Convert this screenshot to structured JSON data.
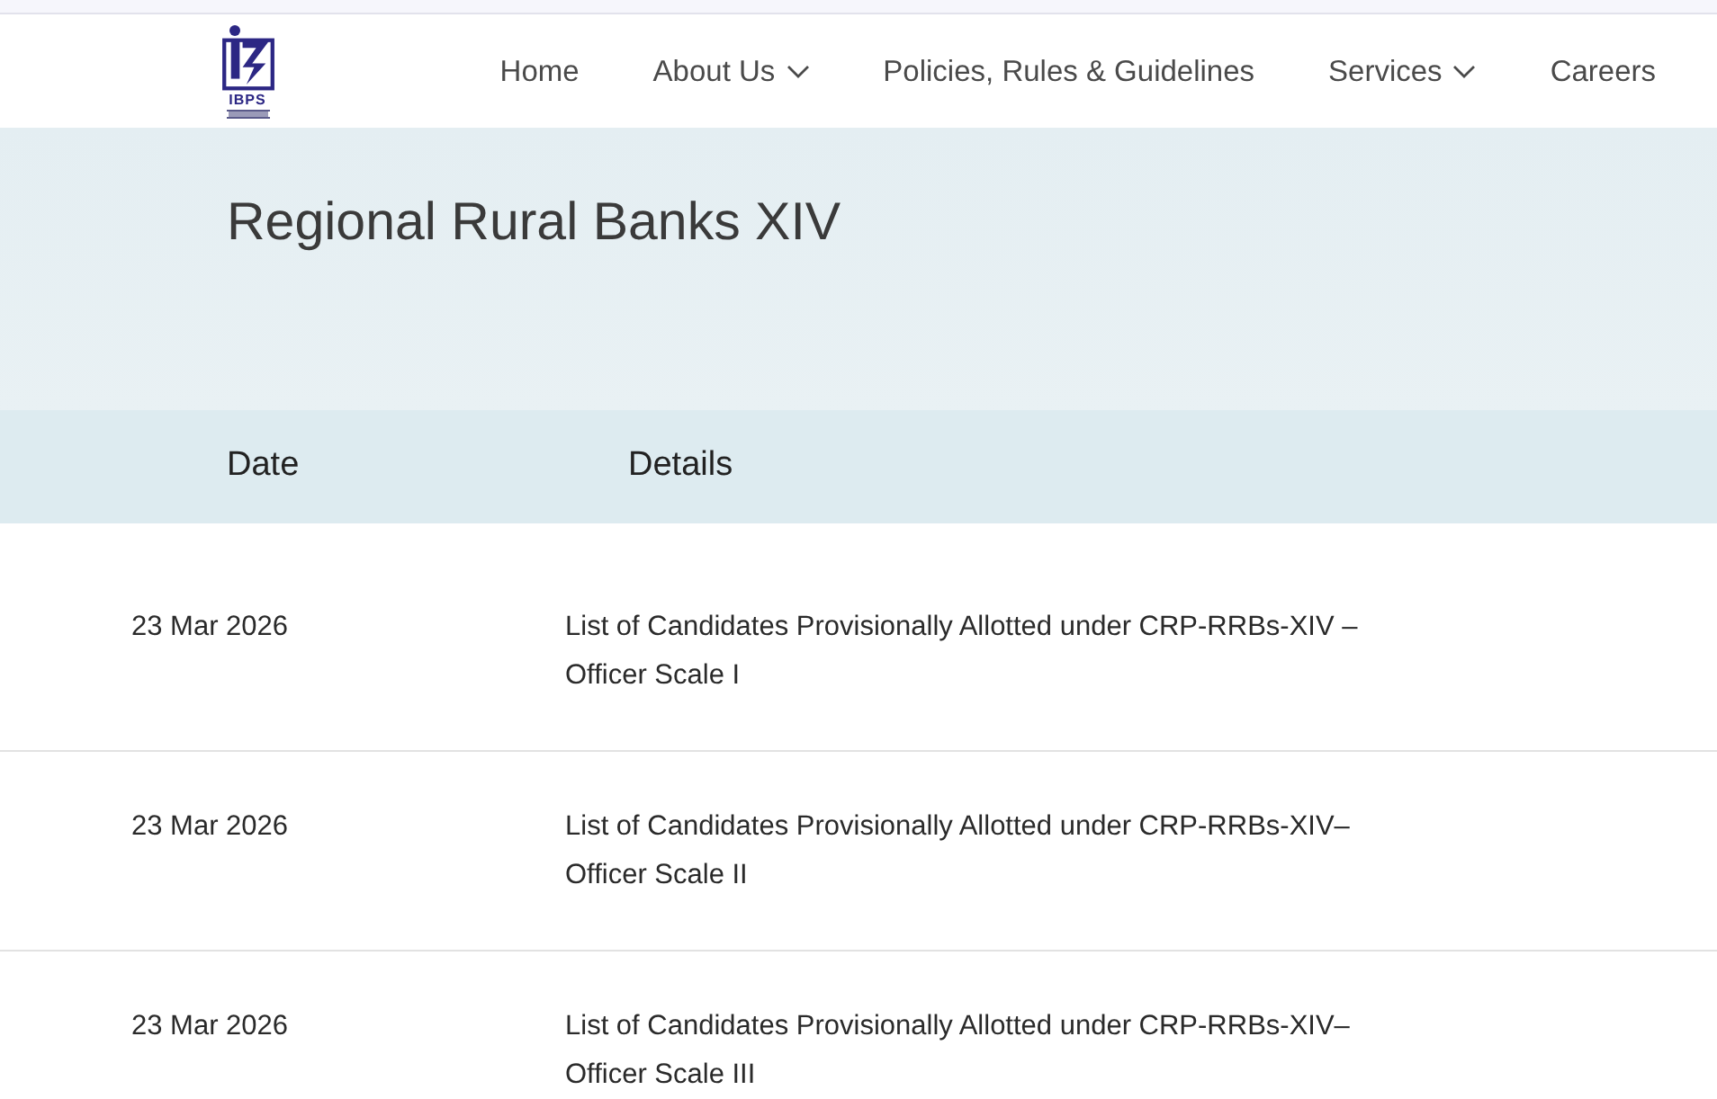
{
  "header": {
    "logo": {
      "text": "IBPS"
    },
    "nav": [
      {
        "label": "Home",
        "has_dropdown": false
      },
      {
        "label": "About Us",
        "has_dropdown": true
      },
      {
        "label": "Policies, Rules & Guidelines",
        "has_dropdown": false
      },
      {
        "label": "Services",
        "has_dropdown": true
      },
      {
        "label": "Careers",
        "has_dropdown": false
      }
    ]
  },
  "page_title": "Regional Rural Banks XIV",
  "table": {
    "columns": [
      "Date",
      "Details"
    ],
    "rows": [
      {
        "date": "23 Mar 2026",
        "details": "List of Candidates Provisionally Allotted under CRP-RRBs-XIV – Officer Scale I"
      },
      {
        "date": "23 Mar 2026",
        "details": "List of Candidates Provisionally Allotted under CRP-RRBs-XIV– Officer Scale II"
      },
      {
        "date": "23 Mar 2026",
        "details": "List of Candidates Provisionally Allotted under CRP-RRBs-XIV– Officer Scale III"
      }
    ]
  }
}
